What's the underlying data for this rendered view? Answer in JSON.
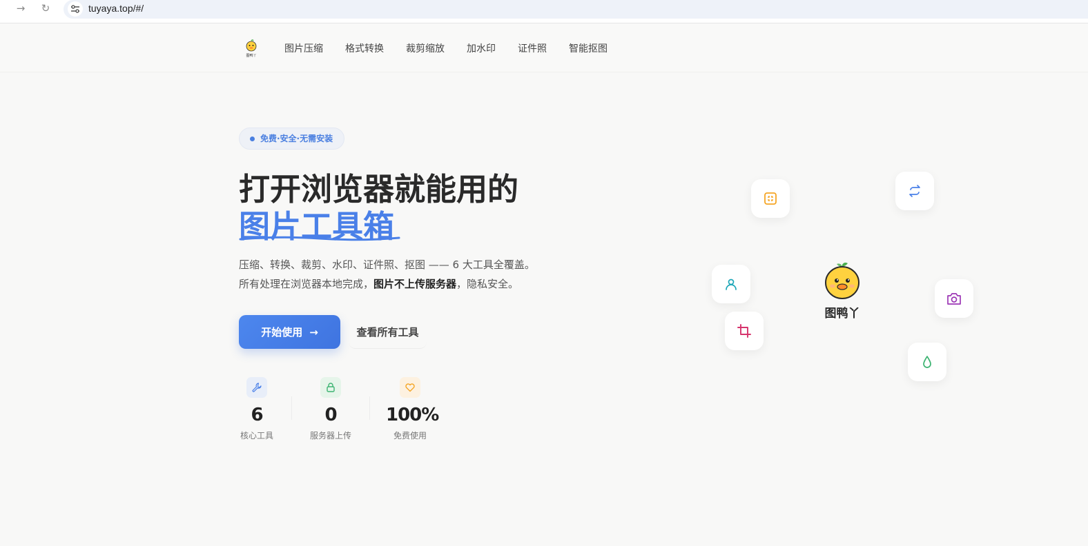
{
  "browser": {
    "url": "tuyaya.top/#/"
  },
  "brand": {
    "name": "图鸭丫"
  },
  "nav": {
    "links": [
      "图片压缩",
      "格式转换",
      "裁剪缩放",
      "加水印",
      "证件照",
      "智能抠图"
    ]
  },
  "hero": {
    "badge": "免费·安全·无需安装",
    "title_line1": "打开浏览器就能用的",
    "title_line2": "图片工具箱",
    "desc_line1": "压缩、转换、裁剪、水印、证件照、抠图 —— 6 大工具全覆盖。",
    "desc_line2_pre": "所有处理在浏览器本地完成，",
    "desc_line2_bold": "图片不上传服务器",
    "desc_line2_post": "，隐私安全。",
    "cta_primary": "开始使用",
    "cta_secondary": "查看所有工具"
  },
  "stats": [
    {
      "value": "6",
      "label": "核心工具",
      "icon": "wrench-icon"
    },
    {
      "value": "0",
      "label": "服务器上传",
      "icon": "lock-icon"
    },
    {
      "value": "100%",
      "label": "免费使用",
      "icon": "heart-icon"
    }
  ],
  "colors": {
    "accent": "#4a80e8",
    "orange": "#f5a524",
    "green": "#3cb371",
    "crimson": "#d6336c",
    "purple": "#9c36b5",
    "teal": "#1ea7b8"
  },
  "floating_tiles": [
    "compress-icon",
    "convert-icon",
    "person-icon",
    "crop-icon",
    "camera-icon",
    "drop-icon"
  ]
}
